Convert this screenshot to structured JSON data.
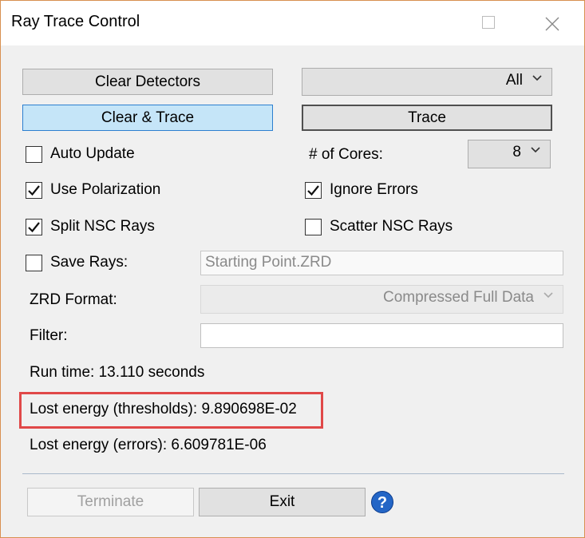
{
  "window": {
    "title": "Ray Trace Control"
  },
  "buttons": {
    "clear_detectors": "Clear Detectors",
    "clear_trace": "Clear & Trace",
    "trace": "Trace",
    "terminate": "Terminate",
    "exit": "Exit"
  },
  "detector_select": {
    "value": "All"
  },
  "options": {
    "auto_update": {
      "label": "Auto Update",
      "checked": false
    },
    "use_polarization": {
      "label": "Use Polarization",
      "checked": true
    },
    "split_nsc_rays": {
      "label": "Split NSC Rays",
      "checked": true
    },
    "ignore_errors": {
      "label": "Ignore Errors",
      "checked": true
    },
    "scatter_nsc_rays": {
      "label": "Scatter NSC Rays",
      "checked": false
    },
    "save_rays": {
      "label": "Save Rays:",
      "checked": false
    }
  },
  "cores": {
    "label": "# of Cores:",
    "value": "8"
  },
  "save_rays_file": {
    "value": "Starting Point.ZRD"
  },
  "zrd_format": {
    "label": "ZRD Format:",
    "value": "Compressed Full Data"
  },
  "filter": {
    "label": "Filter:",
    "value": ""
  },
  "status": {
    "run_time": "Run time: 13.110 seconds",
    "lost_energy_thresholds": "Lost energy (thresholds): 9.890698E-02",
    "lost_energy_errors": "Lost energy (errors): 6.609781E-06"
  },
  "icons": {
    "close": "close-icon",
    "maximize": "maximize-icon",
    "minimize": "minimize-icon",
    "chevron": "chevron-down-icon",
    "help": "help-icon",
    "help_glyph": "?"
  },
  "colors": {
    "window_border": "#d89050",
    "focused_button": "#c5e5f8",
    "highlight": "#e04848",
    "help_icon": "#2466c6"
  }
}
